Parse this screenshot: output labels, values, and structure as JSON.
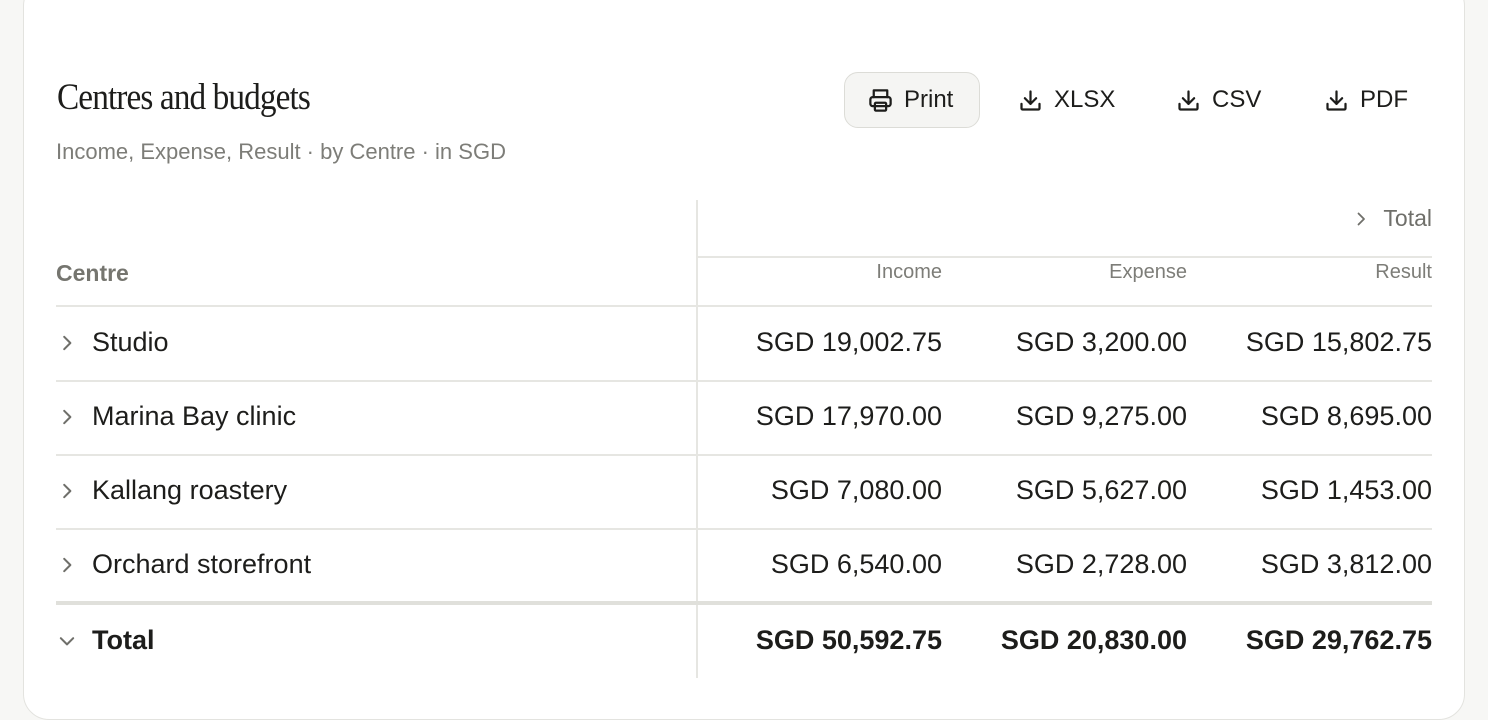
{
  "report": {
    "title": "Centres and budgets",
    "subtitle": "Income, Expense, Result · by Centre · in SGD"
  },
  "toolbar": {
    "print_label": "Print",
    "xlsx_label": "XLSX",
    "csv_label": "CSV",
    "pdf_label": "PDF"
  },
  "table": {
    "group_header": "Total",
    "row_header": "Centre",
    "columns": [
      "Income",
      "Expense",
      "Result"
    ],
    "rows": [
      {
        "label": "Studio",
        "income": "SGD 19,002.75",
        "expense": "SGD 3,200.00",
        "result": "SGD 15,802.75"
      },
      {
        "label": "Marina Bay clinic",
        "income": "SGD 17,970.00",
        "expense": "SGD 9,275.00",
        "result": "SGD 8,695.00"
      },
      {
        "label": "Kallang roastery",
        "income": "SGD 7,080.00",
        "expense": "SGD 5,627.00",
        "result": "SGD 1,453.00"
      },
      {
        "label": "Orchard storefront",
        "income": "SGD 6,540.00",
        "expense": "SGD 2,728.00",
        "result": "SGD 3,812.00"
      }
    ],
    "total": {
      "label": "Total",
      "income": "SGD 50,592.75",
      "expense": "SGD 20,830.00",
      "result": "SGD 29,762.75"
    }
  },
  "icons": {
    "print": "printer-icon",
    "download": "download-icon",
    "expand": "chevron-right-icon",
    "collapse": "chevron-down-icon"
  },
  "colors": {
    "background": "#f7f7f5",
    "card": "#ffffff",
    "text": "#1d1d1b",
    "muted": "#7d7d78",
    "divider": "#e6e6e2"
  }
}
